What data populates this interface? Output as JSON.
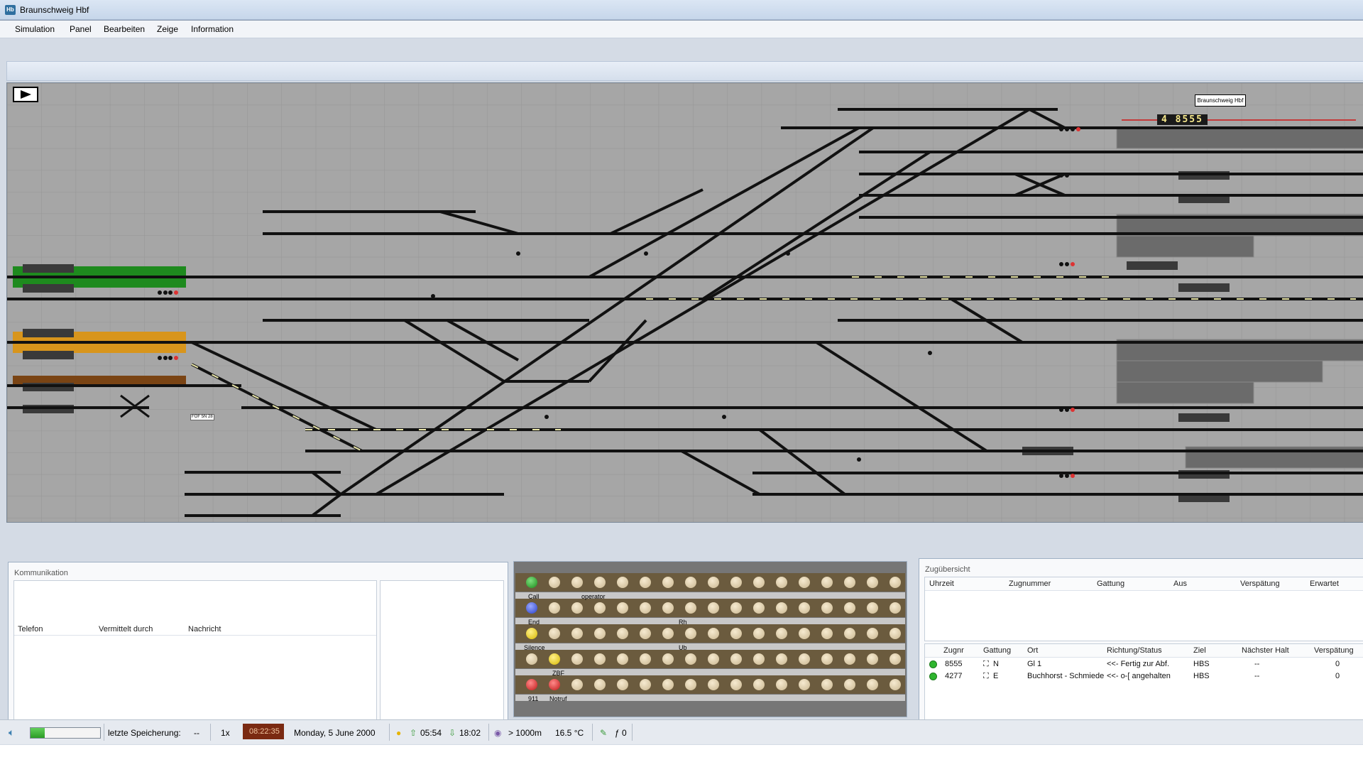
{
  "window": {
    "title": "Braunschweig Hbf",
    "app_icon": "Hb"
  },
  "menu": [
    "Simulation",
    "Panel",
    "Bearbeiten",
    "Zeige",
    "Information"
  ],
  "panel": {
    "station_label": "Braunschweig Hbf",
    "train_display": "4 8555",
    "sign_label": "FOF 5N 28"
  },
  "communication": {
    "title": "Kommunikation",
    "columns": [
      "Telefon",
      "Vermittelt durch",
      "Nachricht"
    ]
  },
  "phone_panel": {
    "labels": {
      "call": "Call",
      "operator": "operator",
      "end": "End",
      "rh": "Rh",
      "silence": "Silence",
      "ub": "Ub",
      "zbf": "ZBF",
      "n911": "911",
      "notruf": "Notruf"
    }
  },
  "trains": {
    "title": "Zugübersicht",
    "schedule_columns": [
      "Uhrzeit",
      "Zugnummer",
      "Gattung",
      "Aus",
      "Verspätung",
      "Erwartet"
    ],
    "list_columns": [
      "Zugnr",
      "Gattung",
      "Ort",
      "Richtung/Status",
      "Ziel",
      "Nächster Halt",
      "Verspätung"
    ],
    "rows": [
      {
        "zugnr": "8555",
        "gattung": "N",
        "ort": "Gl 1",
        "status": "<<- Fertig zur Abf.",
        "ziel": "HBS",
        "naechster": "--",
        "verspaetung": "0"
      },
      {
        "zugnr": "4277",
        "gattung": "E",
        "ort": "Buchhorst - Schmiede",
        "status": "<<- o-[ angehalten",
        "ziel": "HBS",
        "naechster": "--",
        "verspaetung": "0"
      }
    ]
  },
  "status": {
    "save_label": "letzte Speicherung:",
    "save_value": "--",
    "speed": "1x",
    "clock": "08:22:35",
    "date": "Monday, 5 June 2000",
    "sunrise": "05:54",
    "sunset": "18:02",
    "visibility": "> 1000m",
    "temperature": "16.5 °C",
    "counter": "ƒ 0",
    "progress": 0.2
  },
  "colors": {
    "track_green": "#1e8a1e",
    "track_orange": "#d8951c",
    "track_brown": "#7a4414",
    "clock_bg": "#7a2a12"
  }
}
